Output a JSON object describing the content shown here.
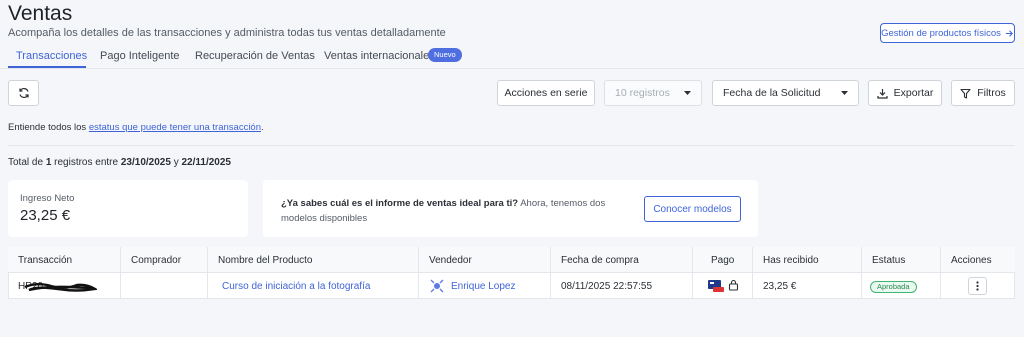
{
  "header": {
    "title": "Ventas",
    "subtitle": "Acompaña los detalles de las transacciones y administra todas tus ventas detalladamente",
    "gestion_label": "Gestión de productos físicos"
  },
  "tabs": [
    {
      "label": "Transacciones",
      "active": true
    },
    {
      "label": "Pago Inteligente"
    },
    {
      "label": "Recuperación de Ventas"
    },
    {
      "label": "Ventas internacionales"
    }
  ],
  "badge_nuevo": "Nuevo",
  "toolbar": {
    "acciones_label": "Acciones en serie",
    "registros_value": "10 registros",
    "fecha_value": "Fecha de la Solicitud",
    "exportar_label": "Exportar",
    "filtros_label": "Filtros"
  },
  "info": {
    "prefix": "Entiende todos los ",
    "link": "estatus que puede tener una transacción",
    "suffix": "."
  },
  "total": {
    "prefix": "Total de ",
    "count": "1",
    "middle": " registros entre ",
    "date_from": "23/10/2025",
    "and": " y ",
    "date_to": "22/11/2025"
  },
  "ingreso": {
    "label": "Ingreso Neto",
    "value": "23,25 €"
  },
  "promo": {
    "bold": "¿Ya sabes cuál es el informe de ventas ideal para ti?",
    "rest": " Ahora, tenemos dos modelos disponibles",
    "button": "Conocer modelos"
  },
  "table": {
    "headers": [
      "Transacción",
      "Comprador",
      "Nombre del Producto",
      "Vendedor",
      "Fecha de compra",
      "Pago",
      "Has recibido",
      "Estatus",
      "Acciones"
    ],
    "row": {
      "transaccion": "HP20",
      "comprador": "",
      "producto": "Curso de iniciación a la fotografía",
      "vendedor": "Enrique Lopez",
      "fecha": "08/11/2025 22:57:55",
      "recibido": "23,25 €",
      "estatus": "Aprobada"
    }
  },
  "colors": {
    "accent": "#3f64d9",
    "success": "#3fb56f"
  },
  "icons": [
    "refresh-icon",
    "arrow-right-icon",
    "chevron-down-icon",
    "download-icon",
    "filter-icon",
    "vendor-icon",
    "card-icon",
    "lock-icon",
    "kebab-icon"
  ]
}
